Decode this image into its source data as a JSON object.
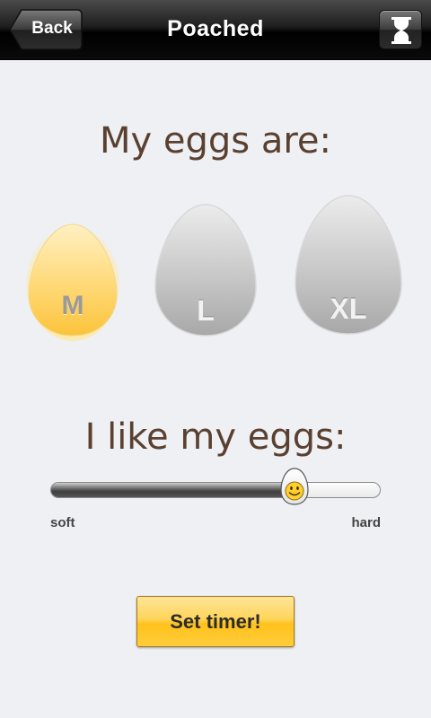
{
  "header": {
    "back_label": "Back",
    "title": "Poached",
    "timer_icon": "hourglass-icon"
  },
  "size_section": {
    "heading": "My eggs are:",
    "selected": "M",
    "sizes": [
      {
        "label": "M",
        "selected": true
      },
      {
        "label": "L",
        "selected": false
      },
      {
        "label": "XL",
        "selected": false
      }
    ]
  },
  "doneness_section": {
    "heading": "I like my eggs:",
    "value_fraction": 0.74,
    "min_label": "soft",
    "max_label": "hard",
    "thumb_icon": "smiley-egg-icon"
  },
  "action": {
    "label": "Set timer!"
  },
  "colors": {
    "accent_yellow": "#ffc21c",
    "heading_brown": "#5a4030",
    "background": "#eef0f4"
  }
}
